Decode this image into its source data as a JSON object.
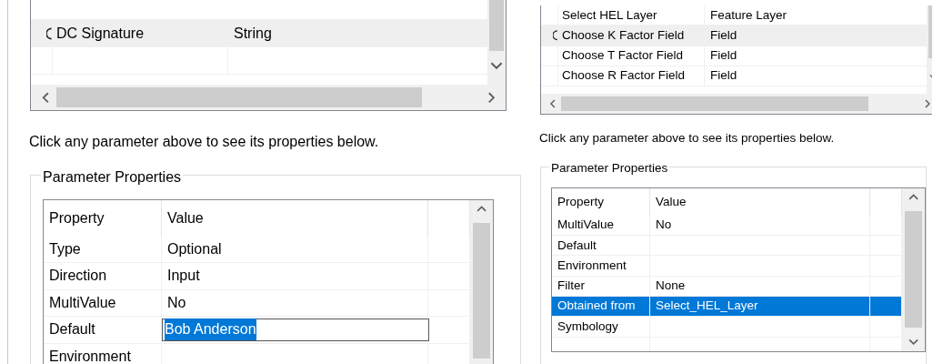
{
  "panels": [
    {
      "parameters_table": {
        "rows": [
          {
            "name": "DC Signature",
            "type": "String",
            "selected": true
          },
          {
            "name": "",
            "type": "",
            "selected": false
          }
        ]
      },
      "hint": "Click any parameter above to see its properties below.",
      "properties": {
        "title": "Parameter Properties",
        "columns": [
          "Property",
          "Value"
        ],
        "rows": [
          {
            "property": "Type",
            "value": "Optional",
            "selected": false,
            "editing": false
          },
          {
            "property": "Direction",
            "value": "Input",
            "selected": false,
            "editing": false
          },
          {
            "property": "MultiValue",
            "value": "No",
            "selected": false,
            "editing": false
          },
          {
            "property": "Default",
            "value": "Bob Anderson",
            "selected": false,
            "editing": true
          },
          {
            "property": "Environment",
            "value": "",
            "selected": false,
            "editing": false
          }
        ]
      }
    },
    {
      "parameters_table": {
        "rows": [
          {
            "name": "Select HEL Layer",
            "type": "Feature Layer",
            "selected": false
          },
          {
            "name": "Choose K Factor Field",
            "type": "Field",
            "selected": true
          },
          {
            "name": "Choose T Factor Field",
            "type": "Field",
            "selected": false
          },
          {
            "name": "Choose R Factor Field",
            "type": "Field",
            "selected": false
          }
        ]
      },
      "hint": "Click any parameter above to see its properties below.",
      "properties": {
        "title": "Parameter Properties",
        "columns": [
          "Property",
          "Value"
        ],
        "rows": [
          {
            "property": "MultiValue",
            "value": "No",
            "selected": false,
            "editing": false
          },
          {
            "property": "Default",
            "value": "",
            "selected": false,
            "editing": false
          },
          {
            "property": "Environment",
            "value": "",
            "selected": false,
            "editing": false
          },
          {
            "property": "Filter",
            "value": "None",
            "selected": false,
            "editing": false
          },
          {
            "property": "Obtained from",
            "value": "Select_HEL_Layer",
            "selected": true,
            "editing": false
          },
          {
            "property": "Symbology",
            "value": "",
            "selected": false,
            "editing": false
          },
          {
            "property": "",
            "value": "",
            "selected": false,
            "editing": false
          }
        ]
      }
    }
  ]
}
